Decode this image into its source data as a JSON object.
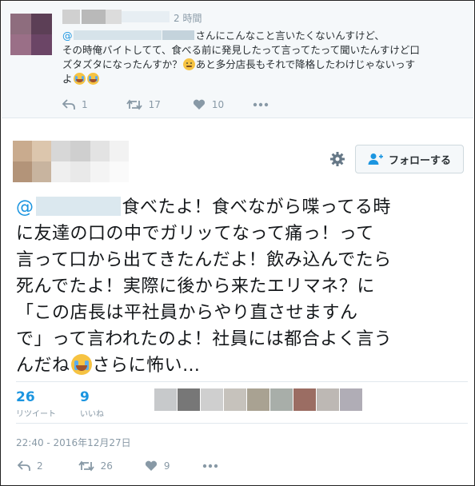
{
  "reply": {
    "time": "2 時間",
    "at_sign": "@",
    "line1_suffix": "さんにこんなこと言いたくないんすけど、",
    "line2": "その時俺バイトしてて、食べる前に発見したって言ってたって聞いたんすけど口",
    "line3": "ズタズタになったんすか？",
    "line3_suffix": "あと多分店長もそれで降格したわけじゃないっす",
    "line4": "よ",
    "actions": {
      "reply_count": "1",
      "retweet_count": "17",
      "like_count": "10"
    }
  },
  "main": {
    "follow_label": "フォロー",
    "follow_suffix": "する",
    "at_sign": "@",
    "text_line1": "食べたよ！食べながら喋ってる時",
    "text_line2": "に友達の口の中でガリッてなって痛っ！って",
    "text_line3": "言って口から出てきたんだよ！飲み込んでたら",
    "text_line4": "死んでたよ！実際に後から来たエリマネ？に",
    "text_line5": "「この店長は平社員からやり直させますん",
    "text_line6": "で」って言われたのよ！社員には都合よく言う",
    "text_line7a": "んだね",
    "text_line7b": "さらに怖い…",
    "retweets_num": "26",
    "retweets_label": "リツイート",
    "likes_num": "9",
    "likes_label": "いいね",
    "timestamp": "22:40 - 2016年12月27日",
    "actions": {
      "reply_count": "2",
      "retweet_count": "26",
      "like_count": "9"
    }
  },
  "colors": {
    "accent": "#1b95e0",
    "muted": "#8899a6",
    "text": "#14171a"
  }
}
